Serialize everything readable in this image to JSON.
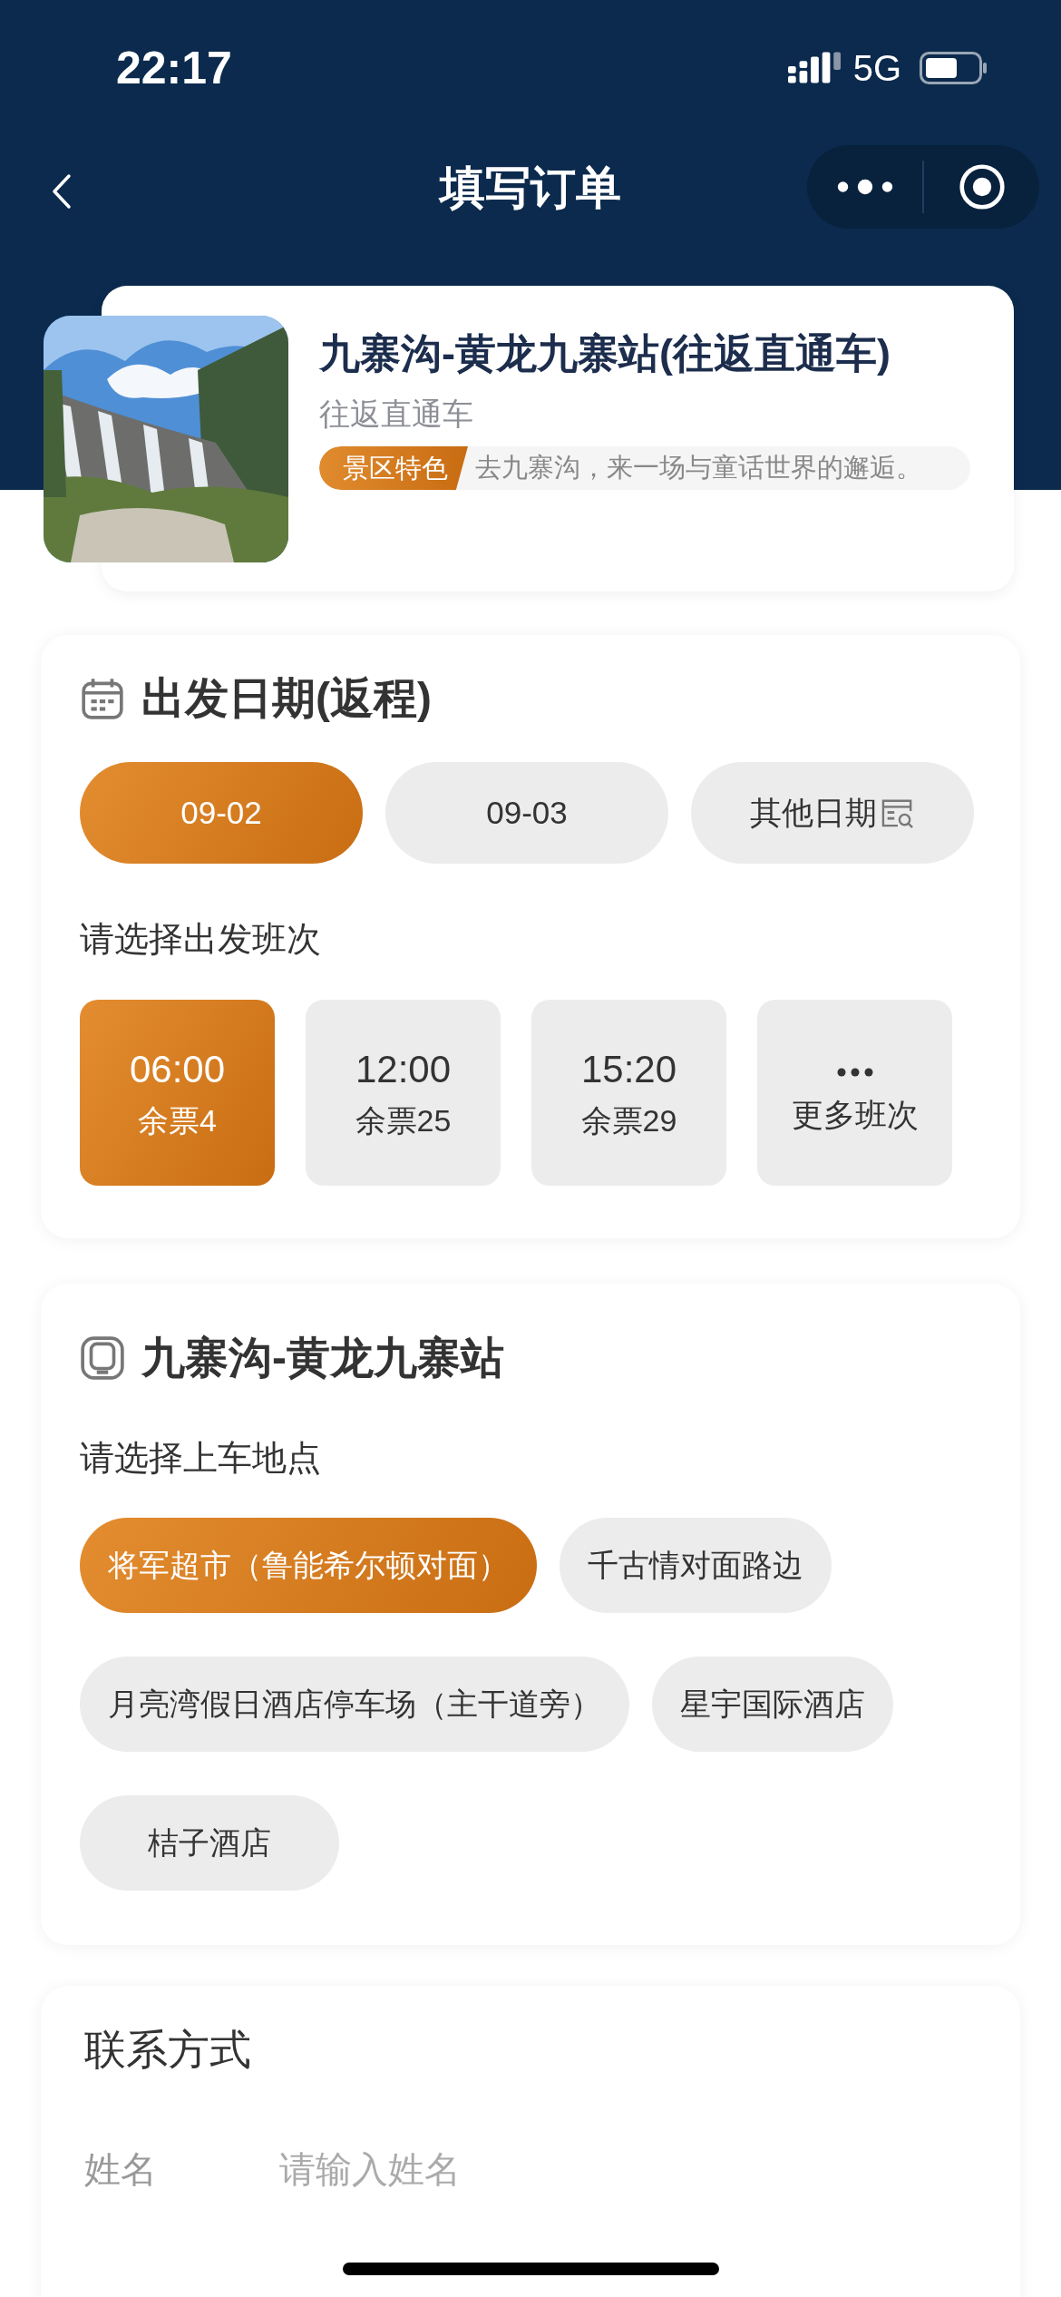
{
  "status_bar": {
    "time": "22:17",
    "network": "5G"
  },
  "nav": {
    "title": "填写订单"
  },
  "product": {
    "title": "九寨沟-黄龙九寨站(往返直通车)",
    "subtitle": "往返直通车",
    "tag": "景区特色",
    "tagline": "去九寨沟，来一场与童话世界的邂逅。"
  },
  "departure": {
    "title": "出发日期(返程)",
    "dates": [
      {
        "kind": "date",
        "label": "09-02",
        "selected": true
      },
      {
        "kind": "date",
        "label": "09-03",
        "selected": false
      },
      {
        "kind": "picker",
        "label": "其他日期",
        "selected": false
      }
    ],
    "schedule_label": "请选择出发班次",
    "trips": [
      {
        "kind": "time",
        "time": "06:00",
        "seats": "余票4",
        "selected": true
      },
      {
        "kind": "time",
        "time": "12:00",
        "seats": "余票25",
        "selected": false
      },
      {
        "kind": "time",
        "time": "15:20",
        "seats": "余票29",
        "selected": false
      },
      {
        "kind": "more",
        "label": "更多班次",
        "selected": false
      }
    ]
  },
  "pickup": {
    "title": "九寨沟-黄龙九寨站",
    "label": "请选择上车地点",
    "stops": [
      {
        "label": "将军超市（鲁能希尔顿对面）",
        "selected": true
      },
      {
        "label": "千古情对面路边",
        "selected": false
      },
      {
        "label": "月亮湾假日酒店停车场（主干道旁）",
        "selected": false
      },
      {
        "label": "星宇国际酒店",
        "selected": false
      },
      {
        "label": "桔子酒店",
        "selected": false
      }
    ]
  },
  "contact": {
    "title": "联系方式",
    "fields": [
      {
        "label": "姓名",
        "placeholder": "请输入姓名"
      }
    ]
  }
}
